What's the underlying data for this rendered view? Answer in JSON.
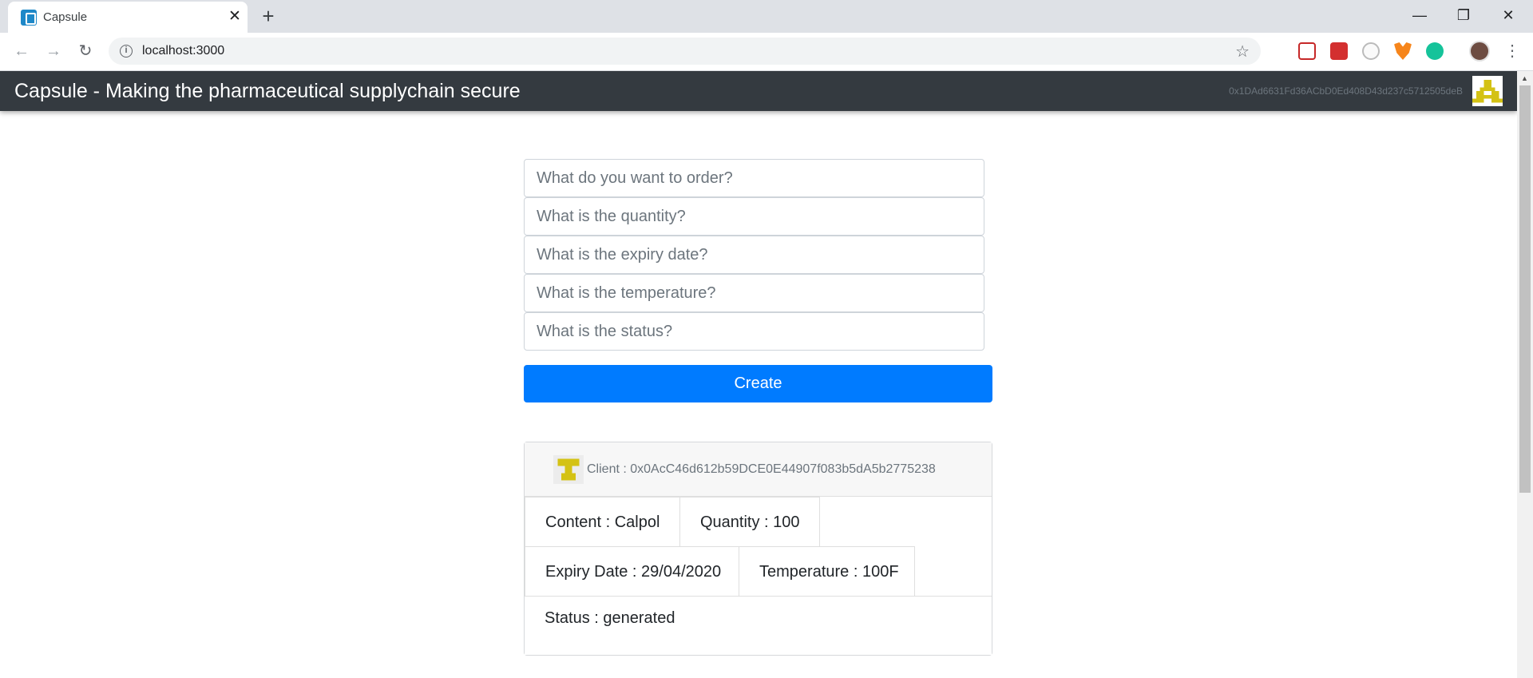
{
  "browser": {
    "tab_title": "Capsule",
    "url": "localhost:3000",
    "extensions": [
      "pocket-icon",
      "red-extension-icon",
      "face-extension-icon",
      "metamask-fox-icon",
      "grammarly-icon"
    ]
  },
  "navbar": {
    "brand": "Capsule - Making the pharmaceutical supplychain secure",
    "account_address": "0x1DAd6631Fd36ACbD0Ed408D43d237c5712505deB"
  },
  "form": {
    "order_placeholder": "What do you want to order?",
    "quantity_placeholder": "What is the quantity?",
    "expiry_placeholder": "What is the expiry date?",
    "temperature_placeholder": "What is the temperature?",
    "status_placeholder": "What is the status?",
    "create_label": "Create"
  },
  "order_card": {
    "client": "Client : 0x0AcC46d612b59DCE0E44907f083b5dA5b2775238",
    "content": "Content : Calpol",
    "quantity": "Quantity : 100",
    "expiry": "Expiry Date : 29/04/2020",
    "temperature": "Temperature : 100F",
    "status": "Status : generated"
  },
  "colors": {
    "navbar": "#343a40",
    "primary": "#007bff",
    "identicon": "#d4c214"
  }
}
